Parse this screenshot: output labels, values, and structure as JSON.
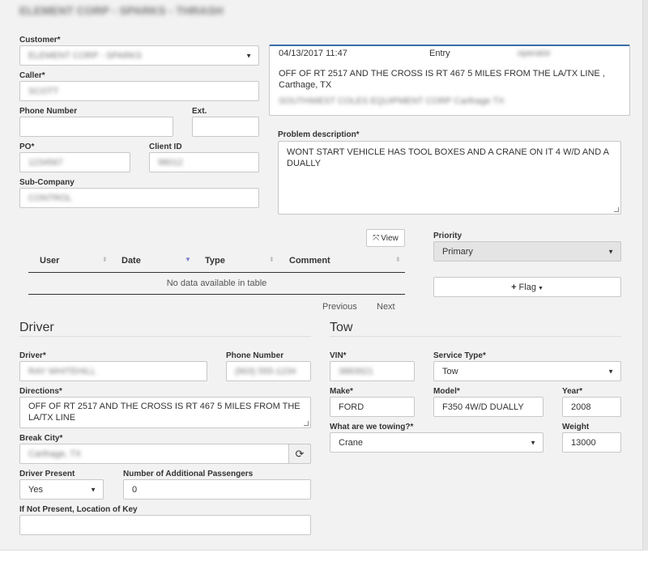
{
  "header": {
    "title": "ELEMENT CORP - SPARKS - THRASH"
  },
  "customer": {
    "label": "Customer*",
    "value": "ELEMENT CORP - SPARKS"
  },
  "caller": {
    "label": "Caller*",
    "value": "SCOTT"
  },
  "phone": {
    "label": "Phone Number",
    "value": ""
  },
  "ext": {
    "label": "Ext.",
    "value": ""
  },
  "po": {
    "label": "PO*",
    "value": "1234567"
  },
  "client_id": {
    "label": "Client ID",
    "value": "98012"
  },
  "sub_company": {
    "label": "Sub-Company",
    "value": "CONTROL"
  },
  "note": {
    "timestamp": "04/13/2017 11:47",
    "type": "Entry",
    "user": "operator",
    "text": "OFF OF RT 2517 AND THE CROSS IS RT 467 5 MILES FROM THE LA/TX LINE , Carthage, TX",
    "sub": "SOUTHWEST COLES EQUIPMENT CORP Carthage TX"
  },
  "problem": {
    "label": "Problem description*",
    "value": "WONT START VEHICLE HAS TOOL BOXES AND A CRANE ON IT 4 W/D AND A DUALLY"
  },
  "view_button": {
    "icon": "expand-icon",
    "label": "View"
  },
  "table": {
    "columns": [
      "User",
      "Date",
      "Type",
      "Comment"
    ],
    "empty": "No data available in table",
    "previous": "Previous",
    "next": "Next"
  },
  "priority": {
    "label": "Priority",
    "value": "Primary"
  },
  "flag_button": {
    "label": "Flag"
  },
  "driver_section": {
    "title": "Driver"
  },
  "driver": {
    "label": "Driver*",
    "value": "RAY WHITEHILL"
  },
  "driver_phone": {
    "label": "Phone Number",
    "value": "(903) 555-1234"
  },
  "directions": {
    "label": "Directions*",
    "value": "OFF OF  RT 2517 AND THE CROSS IS RT 467 5 MILES FROM THE LA/TX LINE"
  },
  "break_city": {
    "label": "Break City*",
    "value": "Carthage, TX"
  },
  "driver_present": {
    "label": "Driver Present",
    "value": "Yes"
  },
  "passengers": {
    "label": "Number of Additional Passengers",
    "value": "0"
  },
  "key_location": {
    "label": "If Not Present, Location of Key",
    "value": ""
  },
  "tow_section": {
    "title": "Tow"
  },
  "vin": {
    "label": "VIN*",
    "value": "3883921"
  },
  "service_type": {
    "label": "Service Type*",
    "value": "Tow"
  },
  "make": {
    "label": "Make*",
    "value": "FORD"
  },
  "model": {
    "label": "Model*",
    "value": "F350 4W/D DUALLY"
  },
  "year": {
    "label": "Year*",
    "value": "2008"
  },
  "towing": {
    "label": "What are we towing?*",
    "value": "Crane"
  },
  "weight": {
    "label": "Weight",
    "value": "13000"
  },
  "colors": {
    "background": "#f2f2f2",
    "accent": "#3a6ea5",
    "border": "#c8c8c8"
  }
}
